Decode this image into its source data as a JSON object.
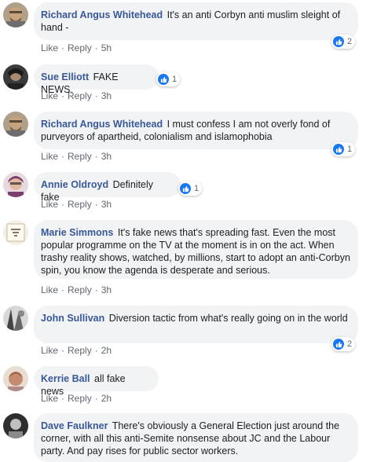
{
  "actions": {
    "like": "Like",
    "reply": "Reply",
    "separator": "·"
  },
  "colors": {
    "author": "#385898",
    "bubble": "#f2f3f5",
    "like_blue": "#1877f2"
  },
  "comments": [
    {
      "author": "Richard Angus Whitehead",
      "text": "It's an anti Corbyn anti muslim sleight of hand -",
      "time": "5h",
      "reactions": "2",
      "reaction_icon": "like-icon"
    },
    {
      "author": "Sue Elliott",
      "text": "FAKE NEWS.",
      "time": "3h",
      "reactions": "1",
      "reaction_icon": "like-icon"
    },
    {
      "author": "Richard Angus Whitehead",
      "text": "I must confess I am not overly fond of purveyors of apartheid, colonialism and islamophobia",
      "time": "3h",
      "reactions": "1",
      "reaction_icon": "like-icon"
    },
    {
      "author": "Annie Oldroyd",
      "text": "Definitely fake",
      "time": "3h",
      "reactions": "1",
      "reaction_icon": "like-icon"
    },
    {
      "author": "Marie Simmons",
      "text": "It's fake news that's spreading fast. Even the most popular programme on the TV at the moment is in on the act. When trashy reality shows, watched, by millions, start to adopt an anti-Corbyn spin, you know the agenda is desperate and serious.",
      "time": "3h"
    },
    {
      "author": "John Sullivan",
      "text": "Diversion tactic from what's really going on in the world",
      "time": "2h",
      "reactions": "2",
      "reaction_icon": "like-icon"
    },
    {
      "author": "Kerrie Ball",
      "text": "all fake news",
      "time": "2h"
    },
    {
      "author": "Dave Faulkner",
      "text": "There's obviously a General Election just around the corner, with all this anti-Semite nonsense about JC and the Labour party. And pay rises for public sector workers."
    }
  ]
}
